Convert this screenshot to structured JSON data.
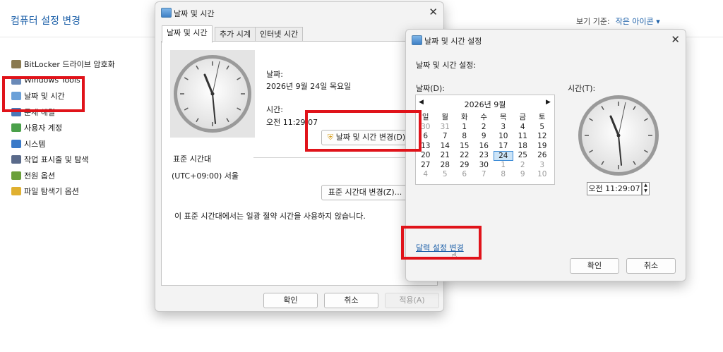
{
  "control_panel": {
    "title": "컴퓨터 설정 변경",
    "view_by_label": "보기 기준:",
    "view_by_value": "작은 아이콘 ▾",
    "items": [
      {
        "label": "BitLocker 드라이브 암호화",
        "icon": "bitlocker-icon",
        "color": "#8a7a50"
      },
      {
        "label": "Windows Tools",
        "icon": "tools-icon",
        "color": "#6a8ab8"
      },
      {
        "label": "날짜 및 시간",
        "icon": "clock-icon",
        "color": "#6aa0d8"
      },
      {
        "label": "문제 해결",
        "icon": "troubleshoot-icon",
        "color": "#4a78b8"
      },
      {
        "label": "사용자 계정",
        "icon": "user-accounts-icon",
        "color": "#4aa04a"
      },
      {
        "label": "시스템",
        "icon": "system-icon",
        "color": "#3a7ac8"
      },
      {
        "label": "작업 표시줄 및 탐색",
        "icon": "taskbar-icon",
        "color": "#5a6a8a"
      },
      {
        "label": "전원 옵션",
        "icon": "power-icon",
        "color": "#6aa03a"
      },
      {
        "label": "파일 탐색기 옵션",
        "icon": "folder-options-icon",
        "color": "#e0b030"
      }
    ]
  },
  "datetime_dialog": {
    "title": "날짜 및 시간",
    "tabs": [
      "날짜 및 시간",
      "추가 시계",
      "인터넷 시간"
    ],
    "date_label": "날짜:",
    "date_value": "2026년 9월 24일 목요일",
    "time_label": "시간:",
    "time_value": "오전 11:29:07",
    "change_button": "날짜 및 시간 변경(D)...",
    "timezone_label": "표준 시간대",
    "timezone_value": "(UTC+09:00) 서울",
    "change_timezone_button": "표준 시간대 변경(Z)...",
    "dst_note": "이 표준 시간대에서는 일광 절약 시간을 사용하지 않습니다.",
    "ok": "확인",
    "cancel": "취소",
    "apply": "적용(A)"
  },
  "settings_dialog": {
    "title": "날짜 및 시간 설정",
    "heading": "날짜 및 시간 설정:",
    "date_label": "날짜(D):",
    "time_label": "시간(T):",
    "month_label": "2026년 9월",
    "weekdays": [
      "일",
      "월",
      "화",
      "수",
      "목",
      "금",
      "토"
    ],
    "weeks": [
      [
        "30",
        "31",
        "1",
        "2",
        "3",
        "4",
        "5"
      ],
      [
        "6",
        "7",
        "8",
        "9",
        "10",
        "11",
        "12"
      ],
      [
        "13",
        "14",
        "15",
        "16",
        "17",
        "18",
        "19"
      ],
      [
        "20",
        "21",
        "22",
        "23",
        "24",
        "25",
        "26"
      ],
      [
        "27",
        "28",
        "29",
        "30",
        "1",
        "2",
        "3"
      ],
      [
        "4",
        "5",
        "6",
        "7",
        "8",
        "9",
        "10"
      ]
    ],
    "selected_day": "24",
    "time_value": "오전 11:29:07",
    "calendar_link": "달력 설정 변경",
    "ok": "확인",
    "cancel": "취소"
  },
  "colors": {
    "highlight": "#e0131a",
    "link": "#1b5fa8"
  }
}
